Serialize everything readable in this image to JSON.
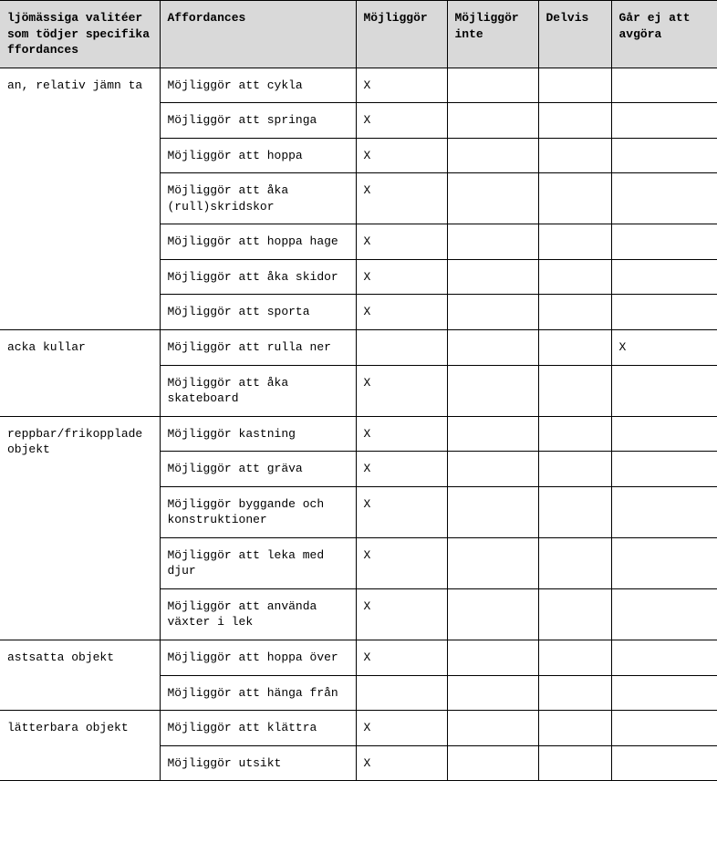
{
  "headers": {
    "col1": "ljömässiga valitéer som tödjer specifika ffordances",
    "col2": "Affordances",
    "col3": "Möjliggör",
    "col4": "Möjliggör inte",
    "col5": "Delvis",
    "col6": "Går ej att avgöra"
  },
  "groups": [
    {
      "quality": "an, relativ jämn ta",
      "rows": [
        {
          "affordance": "Möjliggör att cykla",
          "m": "X",
          "mi": "",
          "d": "",
          "g": ""
        },
        {
          "affordance": "Möjliggör att springa",
          "m": "X",
          "mi": "",
          "d": "",
          "g": ""
        },
        {
          "affordance": "Möjliggör att hoppa",
          "m": "X",
          "mi": "",
          "d": "",
          "g": ""
        },
        {
          "affordance": "Möjliggör att åka (rull)skridskor",
          "m": "X",
          "mi": "",
          "d": "",
          "g": ""
        },
        {
          "affordance": "Möjliggör att hoppa hage",
          "m": "X",
          "mi": "",
          "d": "",
          "g": ""
        },
        {
          "affordance": "Möjliggör att åka skidor",
          "m": "X",
          "mi": "",
          "d": "",
          "g": ""
        },
        {
          "affordance": "Möjliggör att sporta",
          "m": "X",
          "mi": "",
          "d": "",
          "g": ""
        }
      ]
    },
    {
      "quality": "acka kullar",
      "rows": [
        {
          "affordance": "Möjliggör att rulla ner",
          "m": "",
          "mi": "",
          "d": "",
          "g": "X"
        },
        {
          "affordance": "Möjliggör att åka skateboard",
          "m": "X",
          "mi": "",
          "d": "",
          "g": ""
        }
      ]
    },
    {
      "quality": "reppbar/frikopplade objekt",
      "rows": [
        {
          "affordance": "Möjliggör kastning",
          "m": "X",
          "mi": "",
          "d": "",
          "g": ""
        },
        {
          "affordance": "Möjliggör att gräva",
          "m": "X",
          "mi": "",
          "d": "",
          "g": ""
        },
        {
          "affordance": "Möjliggör byggande och konstruktioner",
          "m": "X",
          "mi": "",
          "d": "",
          "g": ""
        },
        {
          "affordance": "Möjliggör att leka med djur",
          "m": "X",
          "mi": "",
          "d": "",
          "g": ""
        },
        {
          "affordance": "Möjliggör att använda växter i lek",
          "m": "X",
          "mi": "",
          "d": "",
          "g": ""
        }
      ]
    },
    {
      "quality": "astsatta objekt",
      "rows": [
        {
          "affordance": "Möjliggör att hoppa över",
          "m": "X",
          "mi": "",
          "d": "",
          "g": ""
        },
        {
          "affordance": "Möjliggör att hänga från",
          "m": "",
          "mi": "",
          "d": "",
          "g": ""
        }
      ]
    },
    {
      "quality": "lätterbara objekt",
      "rows": [
        {
          "affordance": "Möjliggör att klättra",
          "m": "X",
          "mi": "",
          "d": "",
          "g": ""
        },
        {
          "affordance": "Möjliggör utsikt",
          "m": "X",
          "mi": "",
          "d": "",
          "g": ""
        }
      ]
    }
  ]
}
